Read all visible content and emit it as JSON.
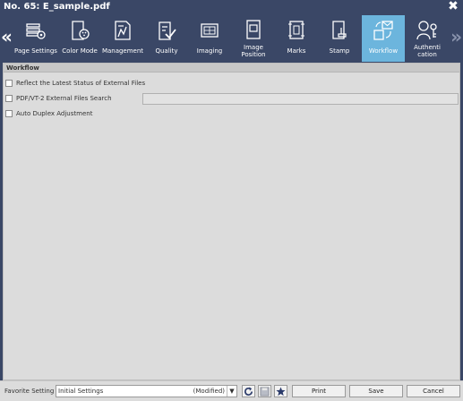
{
  "window": {
    "title": "No. 65: E_sample.pdf",
    "close_glyph": "✖"
  },
  "toolbar": {
    "left_arrow": "«",
    "right_arrow": "»",
    "tabs": [
      {
        "label": "Page Settings",
        "icon": "page-settings-icon",
        "active": false
      },
      {
        "label": "Color Mode",
        "icon": "color-mode-icon",
        "active": false
      },
      {
        "label": "Management",
        "icon": "management-icon",
        "active": false
      },
      {
        "label": "Quality",
        "icon": "quality-icon",
        "active": false
      },
      {
        "label": "Imaging",
        "icon": "imaging-icon",
        "active": false
      },
      {
        "label": "Image Position",
        "icon": "image-position-icon",
        "active": false
      },
      {
        "label": "Marks",
        "icon": "marks-icon",
        "active": false
      },
      {
        "label": "Stamp",
        "icon": "stamp-icon",
        "active": false
      },
      {
        "label": "Workflow",
        "icon": "workflow-icon",
        "active": true
      },
      {
        "label": "Authentication",
        "display_label": "Authenti cation",
        "icon": "authentication-icon",
        "active": false
      }
    ]
  },
  "workflow": {
    "section_title": "Workflow",
    "options": [
      {
        "label": "Reflect the Latest Status of External Files",
        "checked": false
      },
      {
        "label": "PDF/VT-2 External Files Search",
        "checked": false
      },
      {
        "label": "Auto Duplex Adjustment",
        "checked": false
      }
    ],
    "external_search_value": ""
  },
  "footer": {
    "favorite_label": "Favorite Setting",
    "favorite_value": "Initial Settings",
    "favorite_status": "(Modified)",
    "dropdown_glyph": "▼",
    "print_label": "Print",
    "save_label": "Save",
    "cancel_label": "Cancel"
  },
  "colors": {
    "titlebar": "#3a4766",
    "active_tab": "#6cb5dd",
    "panel": "#dcdcdc"
  }
}
